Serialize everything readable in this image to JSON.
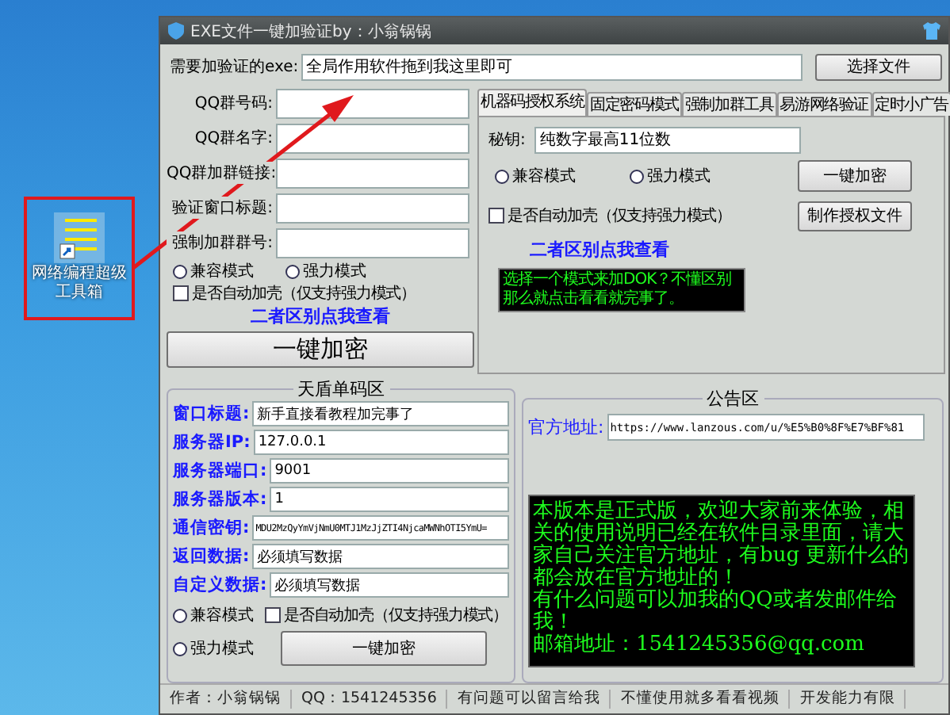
{
  "desktop_icon": {
    "label": "网络编程超级工具箱"
  },
  "window": {
    "title": "EXE文件一键加验证by：小翁锅锅"
  },
  "exe_row": {
    "label": "需要加验证的exe:",
    "value": "全局作用软件拖到我这里即可",
    "button": "选择文件"
  },
  "left_form": {
    "fields": [
      {
        "label": "QQ群号码:"
      },
      {
        "label": "QQ群名字:"
      },
      {
        "label": "QQ群加群链接:"
      },
      {
        "label": "验证窗口标题:"
      },
      {
        "label": "强制加群群号:"
      }
    ],
    "modes": [
      {
        "label": "兼容模式",
        "selected": false
      },
      {
        "label": "强力模式",
        "selected": false
      }
    ],
    "auto_shell": {
      "label": "是否自动加壳（仅支持强力模式）",
      "checked": false
    },
    "link": "二者区别点我查看",
    "button": "一键加密"
  },
  "tabs": [
    {
      "label": "机器码授权系统",
      "selected": true
    },
    {
      "label": "固定密码模式",
      "selected": false
    },
    {
      "label": "强制加群工具",
      "selected": false
    },
    {
      "label": "易游网络验证",
      "selected": false
    },
    {
      "label": "定时小广告",
      "selected": false
    }
  ],
  "tab_panel": {
    "key_label": "秘钥:",
    "key_value": "纯数字最高11位数",
    "modes": [
      {
        "label": "兼容模式",
        "selected": false
      },
      {
        "label": "强力模式",
        "selected": false
      }
    ],
    "encrypt_button": "一键加密",
    "auto_shell": {
      "label": "是否自动加壳（仅支持强力模式）",
      "checked": false
    },
    "license_button": "制作授权文件",
    "link": "二者区别点我查看",
    "console": "选择一个模式来加DOK？不懂区别那么就点击看看就完事了。"
  },
  "tiandun": {
    "title": "天盾单码区",
    "fields": [
      {
        "label": "窗口标题:",
        "value": "新手直接看教程加完事了"
      },
      {
        "label": "服务器IP:",
        "value": "127.0.0.1"
      },
      {
        "label": "服务器端口:",
        "value": "9001"
      },
      {
        "label": "服务器版本:",
        "value": "1"
      },
      {
        "label": "通信密钥:",
        "value": "MDU2MzQyYmVjNmU0MTJ1MzJjZTI4NjcaMWNhOTI5YmU="
      },
      {
        "label": "返回数据:",
        "value": "必须填写数据"
      },
      {
        "label": "自定义数据:",
        "value": "必须填写数据"
      }
    ],
    "modes": [
      {
        "label": "兼容模式",
        "selected": false
      },
      {
        "label": "强力模式",
        "selected": false
      }
    ],
    "auto_shell": {
      "label": "是否自动加壳（仅支持强力模式）",
      "checked": false
    },
    "button": "一键加密"
  },
  "notice": {
    "title": "公告区",
    "url_label": "官方地址:",
    "url": "https://www.lanzous.com/u/%E5%B0%8F%E7%BF%81",
    "message": [
      "本版本是正式版，欢迎大家前来体验，相关的使用说明已经在软件目录里面，请大家自己关注官方地址，有bug 更新什么的都会放在官方地址的！",
      "有什么问题可以加我的QQ或者发邮件给我！",
      "邮箱地址：1541245356@qq.com"
    ]
  },
  "status_bar": [
    "作者：小翁锅锅",
    "QQ：1541245356",
    "有问题可以留言给我",
    "不懂使用就多看看视频",
    "开发能力有限"
  ]
}
